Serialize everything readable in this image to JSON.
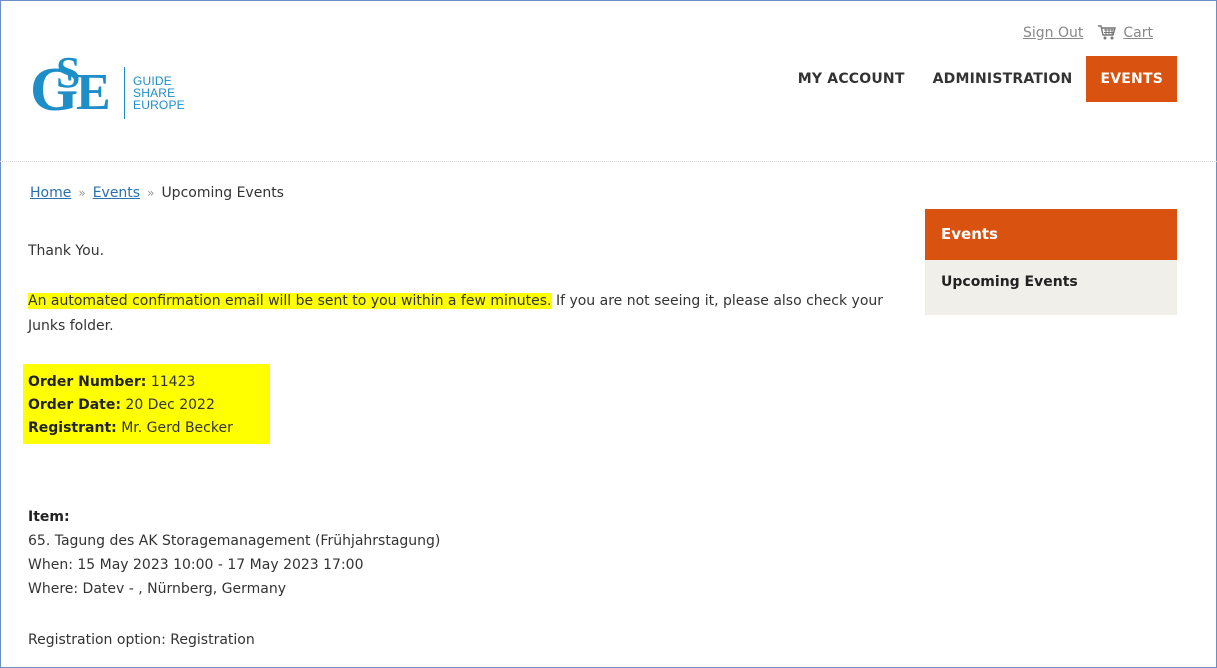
{
  "header": {
    "logo": {
      "letters": "GSE",
      "lines": [
        "GUIDE",
        "SHARE",
        "EUROPE"
      ]
    },
    "toplinks": {
      "sign_out": "Sign Out",
      "cart": "Cart"
    },
    "nav": [
      {
        "label": "MY ACCOUNT",
        "active": false
      },
      {
        "label": "ADMINISTRATION",
        "active": false
      },
      {
        "label": "EVENTS",
        "active": true
      }
    ],
    "accent_color": "#d9520f",
    "brand_color": "#1e8ec8"
  },
  "breadcrumb": {
    "home": "Home",
    "events": "Events",
    "current": "Upcoming Events",
    "separator": "»"
  },
  "content": {
    "thank_you": "Thank You.",
    "confirm_highlighted": "An automated confirmation email will be sent to you within a few minutes.",
    "confirm_rest": " If you are not seeing it, please also check your Junks folder.",
    "order": {
      "number_label": "Order Number:",
      "number_value": "11423",
      "date_label": "Order Date:",
      "date_value": "20 Dec 2022",
      "registrant_label": "Registrant:",
      "registrant_value": "Mr. Gerd Becker"
    },
    "item": {
      "label": "Item:",
      "title": "65. Tagung des AK Storagemanagement (Frühjahrstagung)",
      "when": "When: 15 May 2023 10:00 - 17 May 2023 17:00",
      "where": "Where: Datev - , Nürnberg, Germany"
    },
    "registration_option": "Registration option: Registration"
  },
  "sidebar": {
    "title": "Events",
    "items": [
      "Upcoming Events"
    ]
  },
  "icons": {
    "cart": "cart-icon"
  }
}
